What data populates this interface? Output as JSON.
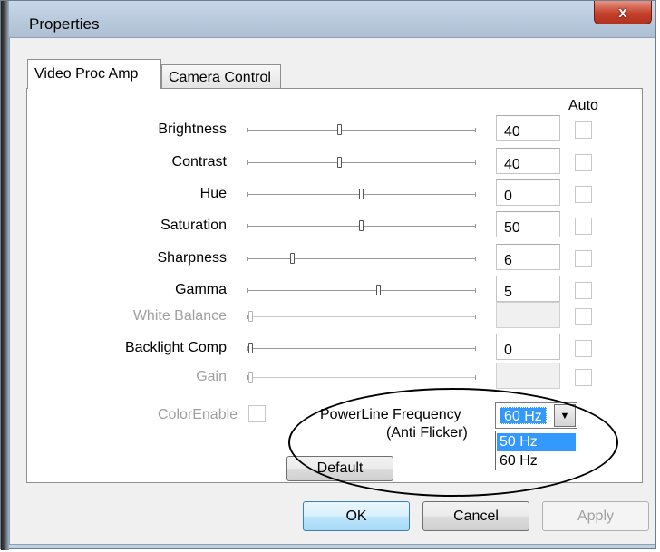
{
  "window": {
    "title": "Properties",
    "close_label": "x"
  },
  "tabs": [
    {
      "label": "Video Proc Amp",
      "active": true
    },
    {
      "label": "Camera Control",
      "active": false
    }
  ],
  "auto_header": "Auto",
  "rows": [
    {
      "label": "Brightness",
      "value": "40",
      "enabled": true
    },
    {
      "label": "Contrast",
      "value": "40",
      "enabled": true
    },
    {
      "label": "Hue",
      "value": "0",
      "enabled": true
    },
    {
      "label": "Saturation",
      "value": "50",
      "enabled": true
    },
    {
      "label": "Sharpness",
      "value": "6",
      "enabled": true
    },
    {
      "label": "Gamma",
      "value": "5",
      "enabled": true
    },
    {
      "label": "White Balance",
      "value": "",
      "enabled": false
    },
    {
      "label": "Backlight Comp",
      "value": "0",
      "enabled": true
    },
    {
      "label": "Gain",
      "value": "",
      "enabled": false
    }
  ],
  "color_enable": {
    "label": "ColorEnable"
  },
  "powerline": {
    "label_line1": "PowerLine Frequency",
    "label_line2": "(Anti Flicker)",
    "selected": "60 Hz",
    "options": [
      "50 Hz",
      "60 Hz"
    ],
    "highlighted": "50 Hz"
  },
  "buttons": {
    "default": "Default",
    "ok": "OK",
    "cancel": "Cancel",
    "apply": "Apply"
  }
}
